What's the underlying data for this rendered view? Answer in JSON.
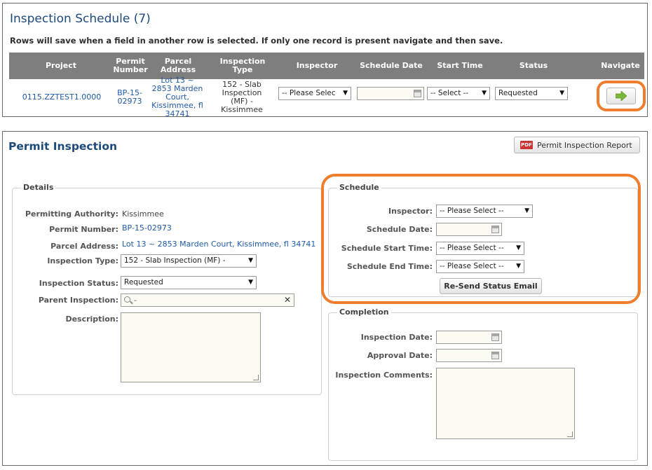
{
  "schedule_panel": {
    "title": "Inspection Schedule (7)",
    "note": "Rows will save when a field in another row is selected. If only one record is present navigate and then save.",
    "columns": [
      "Project",
      "Permit Number",
      "Parcel Address",
      "Inspection Type",
      "Inspector",
      "Schedule Date",
      "Start Time",
      "Status",
      "Navigate"
    ],
    "row": {
      "project": "0115.ZZTEST1.0000",
      "permit_number": "BP-15-02973",
      "parcel_address": "Lot 13 ~ 2853 Marden Court, Kissimmee, fl 34741",
      "inspection_type": "152 - Slab Inspection (MF) - Kissimmee",
      "inspector_select": "-- Please Selec",
      "schedule_date": "",
      "start_time_select": "-- Select --",
      "status_select": "Requested"
    },
    "navigate_icon": "arrow-right-icon"
  },
  "permit_panel": {
    "title": "Permit Inspection",
    "report_button": "Permit Inspection Report",
    "details": {
      "legend": "Details",
      "permitting_authority_label": "Permitting Authority:",
      "permitting_authority": "Kissimmee",
      "permit_number_label": "Permit Number:",
      "permit_number": "BP-15-02973",
      "parcel_address_label": "Parcel Address:",
      "parcel_address": "Lot 13 ~ 2853 Marden Court, Kissimmee, fl 34741",
      "inspection_type_label": "Inspection Type:",
      "inspection_type": "152 - Slab Inspection (MF) -",
      "inspection_status_label": "Inspection Status:",
      "inspection_status": "Requested",
      "parent_inspection_label": "Parent Inspection:",
      "parent_inspection_value": "-",
      "description_label": "Description:"
    },
    "schedule": {
      "legend": "Schedule",
      "inspector_label": "Inspector:",
      "inspector": "-- Please Select --",
      "schedule_date_label": "Schedule Date:",
      "start_time_label": "Schedule Start Time:",
      "start_time": "-- Please Select --",
      "end_time_label": "Schedule End Time:",
      "end_time": "-- Please Select --",
      "resend_button": "Re-Send Status Email"
    },
    "completion": {
      "legend": "Completion",
      "inspection_date_label": "Inspection Date:",
      "approval_date_label": "Approval Date:",
      "comments_label": "Inspection Comments:"
    }
  },
  "colors": {
    "highlight": "#ee7d2e",
    "header_bg": "#7e7e7e",
    "link": "#1e5aa8",
    "title": "#1e4a7a",
    "navigate_arrow": "#7bb83a"
  }
}
